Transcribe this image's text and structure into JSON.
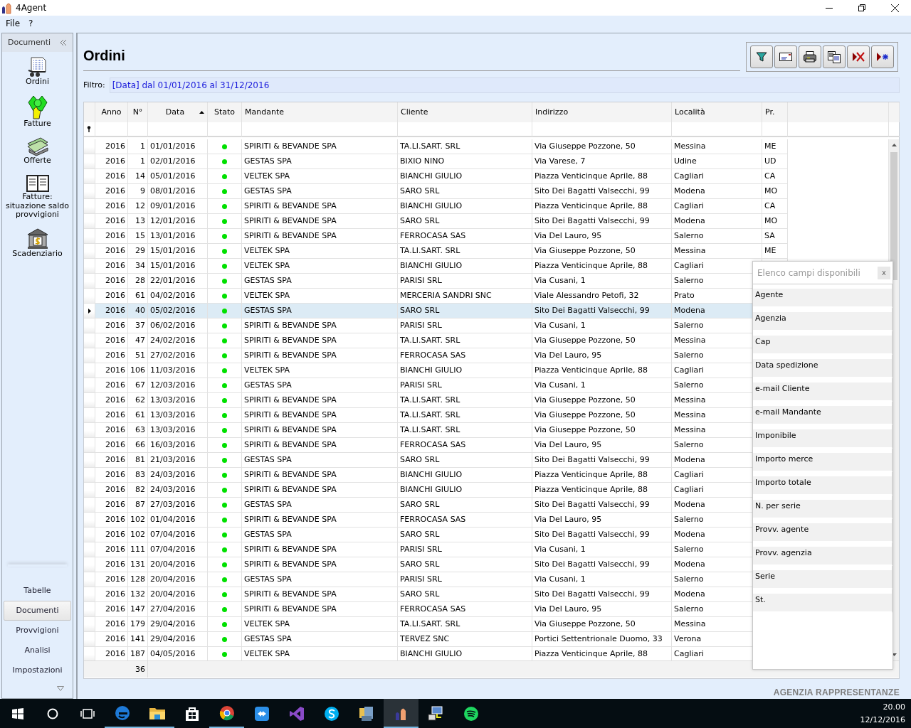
{
  "window": {
    "title": "4Agent"
  },
  "menu": [
    {
      "label": "File"
    },
    {
      "label": "?"
    }
  ],
  "sidebar": {
    "header": "Documenti",
    "items": [
      {
        "label": "Ordini",
        "kind": "cart"
      },
      {
        "label": "Fatture",
        "kind": "money"
      },
      {
        "label": "Offerte",
        "kind": "cash"
      },
      {
        "label": "Fatture: situazione saldo provvigioni",
        "kind": "book"
      },
      {
        "label": "Scadenziario",
        "kind": "bank"
      }
    ],
    "sections": [
      {
        "label": "Tabelle",
        "selected": false
      },
      {
        "label": "Documenti",
        "selected": true
      },
      {
        "label": "Provvigioni",
        "selected": false
      },
      {
        "label": "Analisi",
        "selected": false
      },
      {
        "label": "Impostazioni",
        "selected": false
      }
    ]
  },
  "page": {
    "title": "Ordini",
    "toolbar": [
      {
        "kind": "filter"
      },
      {
        "kind": "envelope"
      },
      {
        "kind": "printer"
      },
      {
        "kind": "copy"
      },
      {
        "kind": "delete"
      },
      {
        "kind": "new"
      }
    ],
    "filter": {
      "label": "Filtro:",
      "value": "[Data] dal 01/01/2016 al 31/12/2016"
    }
  },
  "table": {
    "columns": [
      {
        "label": "Anno",
        "sorted": false
      },
      {
        "label": "N°",
        "sorted": false
      },
      {
        "label": "Data",
        "sorted": true
      },
      {
        "label": "Stato",
        "sorted": false
      },
      {
        "label": "Mandante",
        "sorted": false
      },
      {
        "label": "Cliente",
        "sorted": false
      },
      {
        "label": "Indirizzo",
        "sorted": false
      },
      {
        "label": "Località",
        "sorted": false
      },
      {
        "label": "Pr.",
        "sorted": false
      }
    ],
    "rows": [
      {
        "anno": "2016",
        "n": "1",
        "data": "01/01/2016",
        "color": "#00e000",
        "mandante": "SPIRITI & BEVANDE SPA",
        "cliente": "TA.LI.SART. SRL",
        "indirizzo": "Via Giuseppe Pozzone, 50",
        "localita": "Messina",
        "pr": "ME",
        "selected": false
      },
      {
        "anno": "2016",
        "n": "1",
        "data": "02/01/2016",
        "color": "#00e000",
        "mandante": "GESTAS SPA",
        "cliente": "BIXIO NINO",
        "indirizzo": "Via Varese, 7",
        "localita": "Udine",
        "pr": "UD",
        "selected": false
      },
      {
        "anno": "2016",
        "n": "14",
        "data": "05/01/2016",
        "color": "#00e000",
        "mandante": "VELTEK SPA",
        "cliente": "BIANCHI GIULIO",
        "indirizzo": "Piazza Venticinque Aprile, 88",
        "localita": "Cagliari",
        "pr": "CA",
        "selected": false
      },
      {
        "anno": "2016",
        "n": "9",
        "data": "08/01/2016",
        "color": "#00e000",
        "mandante": "GESTAS SPA",
        "cliente": "SARO SRL",
        "indirizzo": "Sito Dei Bagatti Valsecchi, 99",
        "localita": "Modena",
        "pr": "MO",
        "selected": false
      },
      {
        "anno": "2016",
        "n": "12",
        "data": "09/01/2016",
        "color": "#00e000",
        "mandante": "SPIRITI & BEVANDE SPA",
        "cliente": "BIANCHI GIULIO",
        "indirizzo": "Piazza Venticinque Aprile, 88",
        "localita": "Cagliari",
        "pr": "CA",
        "selected": false
      },
      {
        "anno": "2016",
        "n": "13",
        "data": "12/01/2016",
        "color": "#00e000",
        "mandante": "SPIRITI & BEVANDE SPA",
        "cliente": "SARO SRL",
        "indirizzo": "Sito Dei Bagatti Valsecchi, 99",
        "localita": "Modena",
        "pr": "MO",
        "selected": false
      },
      {
        "anno": "2016",
        "n": "15",
        "data": "13/01/2016",
        "color": "#00e000",
        "mandante": "SPIRITI & BEVANDE SPA",
        "cliente": "FERROCASA SAS",
        "indirizzo": "Via Del Lauro, 95",
        "localita": "Salerno",
        "pr": "SA",
        "selected": false
      },
      {
        "anno": "2016",
        "n": "29",
        "data": "15/01/2016",
        "color": "#00e000",
        "mandante": "VELTEK SPA",
        "cliente": "TA.LI.SART. SRL",
        "indirizzo": "Via Giuseppe Pozzone, 50",
        "localita": "Messina",
        "pr": "ME",
        "selected": false
      },
      {
        "anno": "2016",
        "n": "34",
        "data": "15/01/2016",
        "color": "#00e000",
        "mandante": "VELTEK SPA",
        "cliente": "BIANCHI GIULIO",
        "indirizzo": "Piazza Venticinque Aprile, 88",
        "localita": "Cagliari",
        "selected": false
      },
      {
        "anno": "2016",
        "n": "28",
        "data": "22/01/2016",
        "color": "#00e000",
        "mandante": "GESTAS SPA",
        "cliente": "PARISI SRL",
        "indirizzo": "Via Cusani, 1",
        "localita": "Salerno",
        "selected": false
      },
      {
        "anno": "2016",
        "n": "61",
        "data": "04/02/2016",
        "color": "#00e000",
        "mandante": "VELTEK SPA",
        "cliente": "MERCERIA SANDRI SNC",
        "indirizzo": "Viale Alessandro Petofi, 32",
        "localita": "Prato",
        "selected": false
      },
      {
        "anno": "2016",
        "n": "40",
        "data": "05/02/2016",
        "color": "#00e000",
        "mandante": "GESTAS SPA",
        "cliente": "SARO SRL",
        "indirizzo": "Sito Dei Bagatti Valsecchi, 99",
        "localita": "Modena",
        "selected": true
      },
      {
        "anno": "2016",
        "n": "37",
        "data": "06/02/2016",
        "color": "#00e000",
        "mandante": "SPIRITI & BEVANDE SPA",
        "cliente": "PARISI SRL",
        "indirizzo": "Via Cusani, 1",
        "localita": "Salerno",
        "selected": false
      },
      {
        "anno": "2016",
        "n": "47",
        "data": "24/02/2016",
        "color": "#00e000",
        "mandante": "SPIRITI & BEVANDE SPA",
        "cliente": "TA.LI.SART. SRL",
        "indirizzo": "Via Giuseppe Pozzone, 50",
        "localita": "Messina",
        "selected": false
      },
      {
        "anno": "2016",
        "n": "51",
        "data": "27/02/2016",
        "color": "#00e000",
        "mandante": "SPIRITI & BEVANDE SPA",
        "cliente": "FERROCASA SAS",
        "indirizzo": "Via Del Lauro, 95",
        "localita": "Salerno",
        "selected": false
      },
      {
        "anno": "2016",
        "n": "106",
        "data": "11/03/2016",
        "color": "#00e000",
        "mandante": "VELTEK SPA",
        "cliente": "BIANCHI GIULIO",
        "indirizzo": "Piazza Venticinque Aprile, 88",
        "localita": "Cagliari",
        "selected": false
      },
      {
        "anno": "2016",
        "n": "67",
        "data": "12/03/2016",
        "color": "#00e000",
        "mandante": "GESTAS SPA",
        "cliente": "PARISI SRL",
        "indirizzo": "Via Cusani, 1",
        "localita": "Salerno",
        "selected": false
      },
      {
        "anno": "2016",
        "n": "62",
        "data": "13/03/2016",
        "color": "#00e000",
        "mandante": "SPIRITI & BEVANDE SPA",
        "cliente": "TA.LI.SART. SRL",
        "indirizzo": "Via Giuseppe Pozzone, 50",
        "localita": "Messina",
        "selected": false
      },
      {
        "anno": "2016",
        "n": "61",
        "data": "13/03/2016",
        "color": "#00e000",
        "mandante": "SPIRITI & BEVANDE SPA",
        "cliente": "TA.LI.SART. SRL",
        "indirizzo": "Via Giuseppe Pozzone, 50",
        "localita": "Messina",
        "selected": false
      },
      {
        "anno": "2016",
        "n": "63",
        "data": "13/03/2016",
        "color": "#00e000",
        "mandante": "SPIRITI & BEVANDE SPA",
        "cliente": "TA.LI.SART. SRL",
        "indirizzo": "Via Giuseppe Pozzone, 50",
        "localita": "Messina",
        "selected": false
      },
      {
        "anno": "2016",
        "n": "66",
        "data": "16/03/2016",
        "color": "#00e000",
        "mandante": "SPIRITI & BEVANDE SPA",
        "cliente": "FERROCASA SAS",
        "indirizzo": "Via Del Lauro, 95",
        "localita": "Salerno",
        "selected": false
      },
      {
        "anno": "2016",
        "n": "81",
        "data": "21/03/2016",
        "color": "#00e000",
        "mandante": "GESTAS SPA",
        "cliente": "SARO SRL",
        "indirizzo": "Sito Dei Bagatti Valsecchi, 99",
        "localita": "Modena",
        "selected": false
      },
      {
        "anno": "2016",
        "n": "83",
        "data": "24/03/2016",
        "color": "#00e000",
        "mandante": "SPIRITI & BEVANDE SPA",
        "cliente": "BIANCHI GIULIO",
        "indirizzo": "Piazza Venticinque Aprile, 88",
        "localita": "Cagliari",
        "selected": false
      },
      {
        "anno": "2016",
        "n": "82",
        "data": "24/03/2016",
        "color": "#00e000",
        "mandante": "SPIRITI & BEVANDE SPA",
        "cliente": "BIANCHI GIULIO",
        "indirizzo": "Piazza Venticinque Aprile, 88",
        "localita": "Cagliari",
        "selected": false
      },
      {
        "anno": "2016",
        "n": "87",
        "data": "27/03/2016",
        "color": "#00e000",
        "mandante": "GESTAS SPA",
        "cliente": "SARO SRL",
        "indirizzo": "Sito Dei Bagatti Valsecchi, 99",
        "localita": "Modena",
        "selected": false
      },
      {
        "anno": "2016",
        "n": "102",
        "data": "01/04/2016",
        "color": "#00e000",
        "mandante": "SPIRITI & BEVANDE SPA",
        "cliente": "FERROCASA SAS",
        "indirizzo": "Via Del Lauro, 95",
        "localita": "Salerno",
        "selected": false
      },
      {
        "anno": "2016",
        "n": "102",
        "data": "07/04/2016",
        "color": "#00e000",
        "mandante": "GESTAS SPA",
        "cliente": "SARO SRL",
        "indirizzo": "Sito Dei Bagatti Valsecchi, 99",
        "localita": "Modena",
        "selected": false
      },
      {
        "anno": "2016",
        "n": "111",
        "data": "07/04/2016",
        "color": "#00e000",
        "mandante": "SPIRITI & BEVANDE SPA",
        "cliente": "PARISI SRL",
        "indirizzo": "Via Cusani, 1",
        "localita": "Salerno",
        "selected": false
      },
      {
        "anno": "2016",
        "n": "131",
        "data": "20/04/2016",
        "color": "#00e000",
        "mandante": "SPIRITI & BEVANDE SPA",
        "cliente": "SARO SRL",
        "indirizzo": "Sito Dei Bagatti Valsecchi, 99",
        "localita": "Modena",
        "selected": false
      },
      {
        "anno": "2016",
        "n": "128",
        "data": "20/04/2016",
        "color": "#00e000",
        "mandante": "GESTAS SPA",
        "cliente": "PARISI SRL",
        "indirizzo": "Via Cusani, 1",
        "localita": "Salerno",
        "selected": false
      },
      {
        "anno": "2016",
        "n": "132",
        "data": "20/04/2016",
        "color": "#00e000",
        "mandante": "SPIRITI & BEVANDE SPA",
        "cliente": "SARO SRL",
        "indirizzo": "Sito Dei Bagatti Valsecchi, 99",
        "localita": "Modena",
        "selected": false
      },
      {
        "anno": "2016",
        "n": "147",
        "data": "27/04/2016",
        "color": "#00e000",
        "mandante": "SPIRITI & BEVANDE SPA",
        "cliente": "FERROCASA SAS",
        "indirizzo": "Via Del Lauro, 95",
        "localita": "Salerno",
        "selected": false
      },
      {
        "anno": "2016",
        "n": "179",
        "data": "29/04/2016",
        "color": "#00e000",
        "mandante": "VELTEK SPA",
        "cliente": "TA.LI.SART. SRL",
        "indirizzo": "Via Giuseppe Pozzone, 50",
        "localita": "Messina",
        "selected": false
      },
      {
        "anno": "2016",
        "n": "141",
        "data": "29/04/2016",
        "color": "#00e000",
        "mandante": "GESTAS SPA",
        "cliente": "TERVEZ SNC",
        "indirizzo": "Portici Settentrionale Duomo, 33",
        "localita": "Verona",
        "selected": false
      },
      {
        "anno": "2016",
        "n": "187",
        "data": "04/05/2016",
        "color": "#00e000",
        "mandante": "VELTEK SPA",
        "cliente": "BIANCHI GIULIO",
        "indirizzo": "Piazza Venticinque Aprile, 88",
        "localita": "Cagliari",
        "selected": false
      }
    ],
    "footer": {
      "count": "36"
    }
  },
  "field_chooser": {
    "title": "Elenco campi disponibili",
    "close": "x",
    "fields": [
      "Agente",
      "Agenzia",
      "Cap",
      "Data spedizione",
      "e-mail Cliente",
      "e-mail Mandante",
      "Imponibile",
      "Importo merce",
      "Importo totale",
      "N. per serie",
      "Provv. agente",
      "Provv. agenzia",
      "Serie",
      "St."
    ]
  },
  "brand": "AGENZIA RAPPRESENTANZE",
  "taskbar": {
    "apps": [
      {
        "kind": "start",
        "running": false,
        "selected": false
      },
      {
        "kind": "search",
        "running": false,
        "selected": false
      },
      {
        "kind": "taskview",
        "running": false,
        "selected": false
      },
      {
        "kind": "edge",
        "running": true,
        "selected": false
      },
      {
        "kind": "folder",
        "running": true,
        "selected": false
      },
      {
        "kind": "store",
        "running": false,
        "selected": false
      },
      {
        "kind": "chrome",
        "running": true,
        "selected": false
      },
      {
        "kind": "remote",
        "running": false,
        "selected": false
      },
      {
        "kind": "studio",
        "running": false,
        "selected": false
      },
      {
        "kind": "skype",
        "running": false,
        "selected": false
      },
      {
        "kind": "tools",
        "running": false,
        "selected": false
      },
      {
        "kind": "agent",
        "running": true,
        "selected": true
      },
      {
        "kind": "network",
        "running": false,
        "selected": false
      },
      {
        "kind": "music",
        "running": false,
        "selected": false
      }
    ],
    "time": "20.00",
    "date": "12/12/2016"
  }
}
